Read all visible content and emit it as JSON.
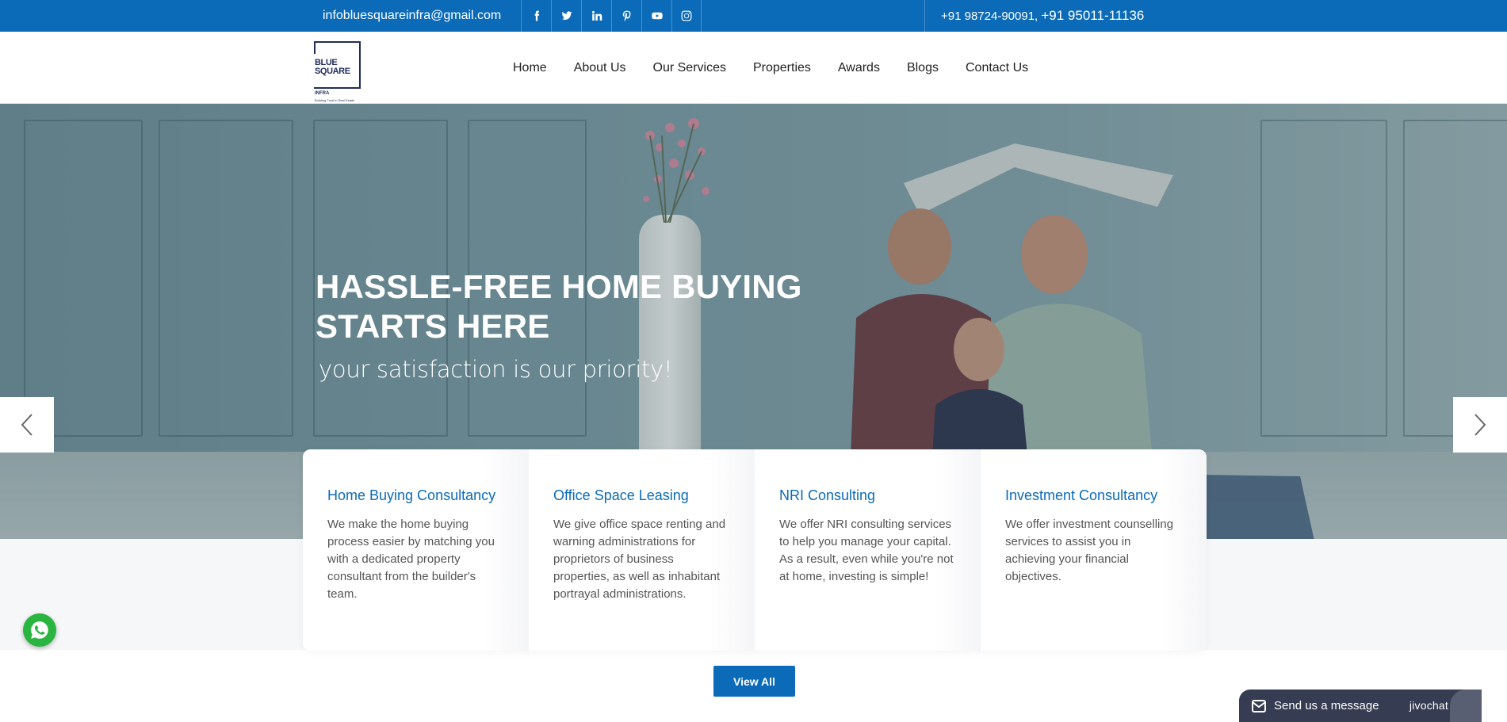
{
  "topbar": {
    "email": "infobluesquareinfra@gmail.com",
    "social_icons": [
      "facebook-icon",
      "twitter-icon",
      "linkedin-icon",
      "pinterest-icon",
      "youtube-icon",
      "instagram-icon"
    ],
    "phone1": "+91 98724-90091",
    "separator": ", ",
    "phone2": "+91 95011-11136",
    "bg_color": "#0b6bb8"
  },
  "logo": {
    "line1": "BLUE",
    "line2": "SQUARE",
    "line3": "INFRA",
    "tagline": "Building Trust in Real Estate"
  },
  "nav": {
    "items": [
      "Home",
      "About Us",
      "Our Services",
      "Properties",
      "Awards",
      "Blogs",
      "Contact Us"
    ]
  },
  "hero": {
    "title": "HASSLE-FREE HOME BUYING STARTS HERE",
    "subtitle": "your satisfaction is our priority!"
  },
  "services": [
    {
      "title": "Home Buying Consultancy",
      "text": "We make the home buying process easier by matching you with a dedicated property consultant from the builder's team."
    },
    {
      "title": "Office Space Leasing",
      "text": "We give office space renting and warning administrations for proprietors of business properties, as well as inhabitant portrayal administrations."
    },
    {
      "title": "NRI Consulting",
      "text": "We offer NRI consulting services to help you manage your capital. As a result, even while you're not at home, investing is simple!"
    },
    {
      "title": "Investment Consultancy",
      "text": "We offer investment counselling services to assist you in achieving your financial objectives."
    }
  ],
  "view_all_label": "View All",
  "chat": {
    "message_label": "Send us a message",
    "brand": "jivochat"
  },
  "colors": {
    "accent": "#0b6bb8",
    "whatsapp": "#2ab540",
    "chat_bg": "#363c51"
  }
}
